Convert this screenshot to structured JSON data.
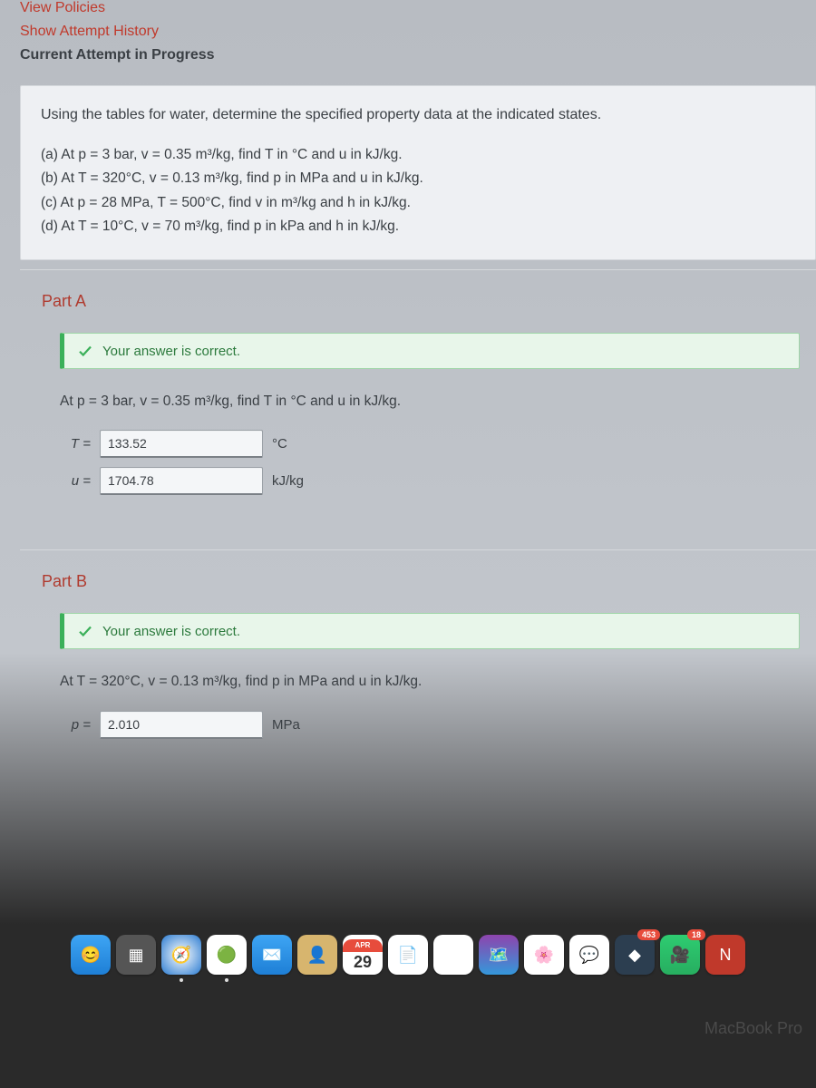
{
  "topLinks": {
    "viewPolicies": "View Policies",
    "showAttempt": "Show Attempt History",
    "current": "Current Attempt in Progress"
  },
  "question": {
    "intro": "Using the tables for water, determine the specified property data at the indicated states.",
    "lines": {
      "a": "(a) At p = 3 bar, v = 0.35 m³/kg, find T in °C and u in kJ/kg.",
      "b": "(b) At T = 320°C, v = 0.13 m³/kg, find p in MPa and u in kJ/kg.",
      "c": "(c) At p = 28 MPa, T = 500°C, find v in m³/kg and h in kJ/kg.",
      "d": "(d) At T = 10°C, v = 70 m³/kg, find p in kPa and h in kJ/kg."
    }
  },
  "feedback": {
    "correct": "Your answer is correct."
  },
  "partA": {
    "title": "Part A",
    "prompt": "At p = 3 bar, v = 0.35 m³/kg, find T in °C and u in kJ/kg.",
    "rows": [
      {
        "var": "T =",
        "value": "133.52",
        "unit": "°C"
      },
      {
        "var": "u =",
        "value": "1704.78",
        "unit": "kJ/kg"
      }
    ]
  },
  "partB": {
    "title": "Part B",
    "prompt": "At T = 320°C, v = 0.13 m³/kg, find p in MPa and u in kJ/kg.",
    "rows": [
      {
        "var": "p =",
        "value": "2.010",
        "unit": "MPa"
      }
    ]
  },
  "dock": {
    "calendar": {
      "month": "APR",
      "day": "29"
    },
    "badges": {
      "inkscape": "453",
      "facetime": "18"
    }
  },
  "macbook": "MacBook Pro"
}
